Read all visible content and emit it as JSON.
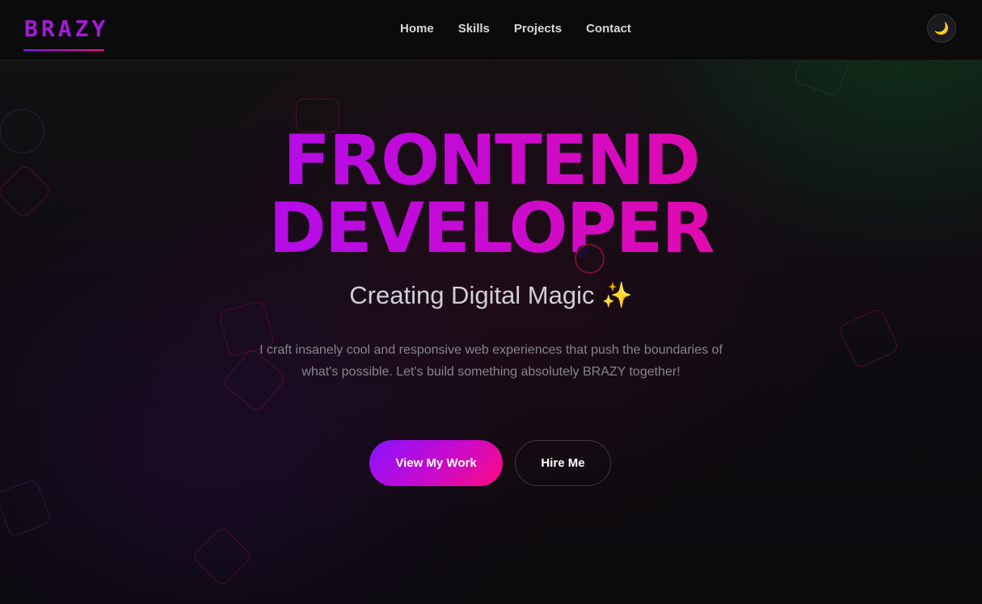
{
  "brand": {
    "logo": "BRAZY",
    "accent_start": "#8a14ff",
    "accent_end": "#ff0a8a"
  },
  "nav": {
    "links": [
      "Home",
      "Skills",
      "Projects",
      "Contact"
    ],
    "theme_toggle_icon": "moon-icon",
    "theme_toggle_glyph": "🌙"
  },
  "hero": {
    "title_line1": "FRONTEND",
    "title_line2": "DEVELOPER",
    "subtitle": "Creating Digital Magic",
    "subtitle_emoji": "✨",
    "description": "I craft insanely cool and responsive web experiences that push the boundaries of what's possible. Let's build something absolutely BRAZY together!",
    "primary_button": "View My Work",
    "secondary_button": "Hire Me"
  },
  "colors": {
    "background": "#0b0a0d",
    "nav_text": "#d7d7da",
    "description_text": "#85858a"
  }
}
